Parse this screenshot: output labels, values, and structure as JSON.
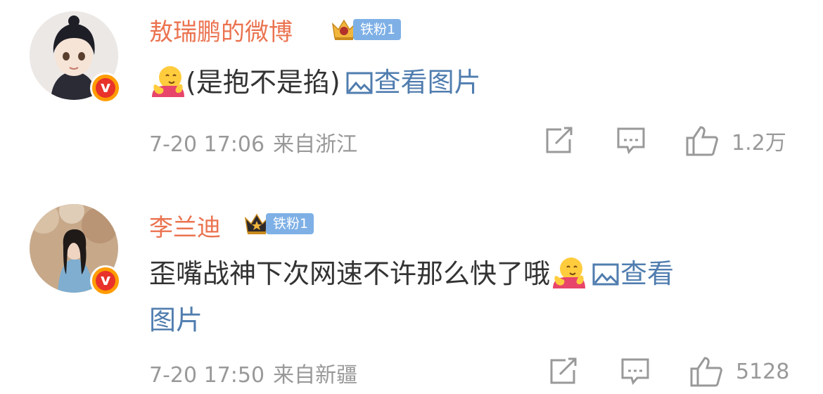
{
  "comments": [
    {
      "username": "敖瑞鹏的微博",
      "fan_badge": "铁粉1",
      "text_before": "(是抱不是掐)",
      "image_link": "查看图片",
      "time": "7-20 17:06",
      "location": "来自浙江",
      "like_count": "1.2万",
      "avatar_icon": "cartoon-character-avatar",
      "verified_badge": "v"
    },
    {
      "username": "李兰迪",
      "fan_badge": "铁粉1",
      "text_before": "歪嘴战神下次网速不许那么快了哦",
      "image_link_line1": "查看",
      "image_link_line2": "图片",
      "time": "7-20 17:50",
      "location": "来自新疆",
      "like_count": "5128",
      "avatar_icon": "photo-avatar",
      "verified_badge": "v"
    }
  ],
  "colors": {
    "username": "#eb7350",
    "link": "#507daf",
    "meta": "#999999",
    "text": "#333333",
    "fan_pill": "#7eb0e6"
  },
  "icons": [
    "share-icon",
    "comment-icon",
    "like-icon",
    "image-icon",
    "hug-emoji",
    "crown-icon"
  ]
}
